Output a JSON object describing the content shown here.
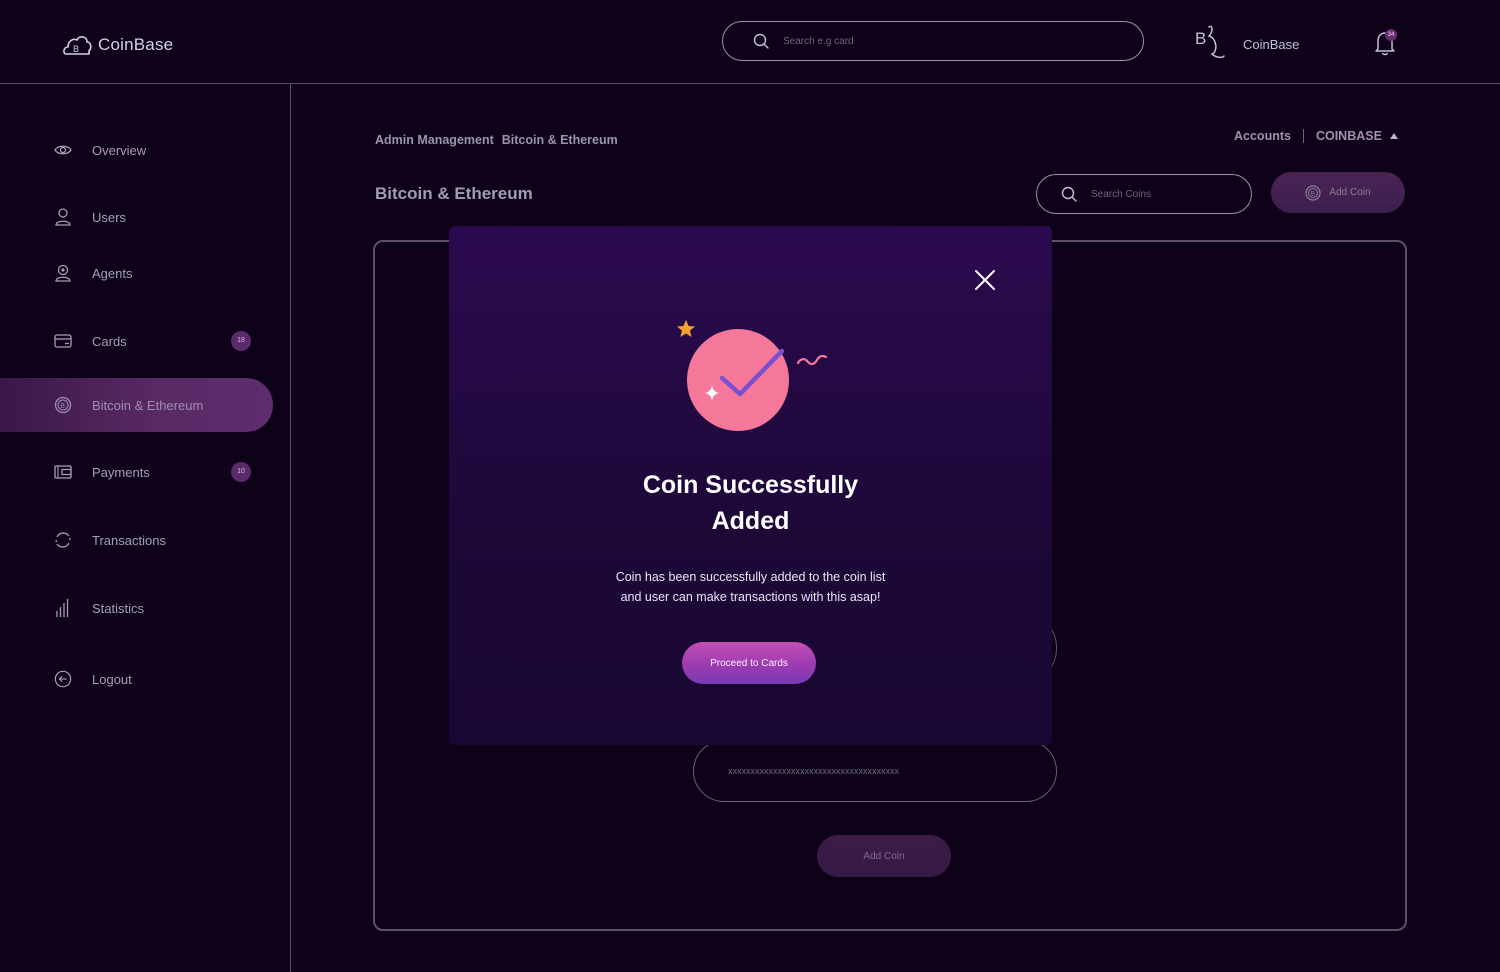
{
  "header": {
    "brand": "CoinBase",
    "search_placeholder": "Search e.g card",
    "user_name": "CoinBase",
    "notification_count": "34"
  },
  "sidebar": {
    "items": [
      {
        "label": "Overview",
        "icon": "eye-icon"
      },
      {
        "label": "Users",
        "icon": "user-icon"
      },
      {
        "label": "Agents",
        "icon": "agent-icon"
      },
      {
        "label": "Cards",
        "icon": "card-icon",
        "badge": "18"
      },
      {
        "label": "Bitcoin & Ethereum",
        "icon": "bitcoin-icon",
        "active": true
      },
      {
        "label": "Payments",
        "icon": "wallet-icon",
        "badge": "10"
      },
      {
        "label": "Transactions",
        "icon": "refresh-icon"
      },
      {
        "label": "Statistics",
        "icon": "chart-icon"
      },
      {
        "label": "Logout",
        "icon": "logout-icon"
      }
    ]
  },
  "main": {
    "breadcrumb": [
      "Admin Management",
      "Bitcoin & Ethereum"
    ],
    "accounts_label": "Accounts",
    "account_selector": "COINBASE",
    "page_title": "Bitcoin & Ethereum",
    "search_placeholder": "Search Coins",
    "add_coin_label": "Add Coin",
    "key_placeholder": "xxxxxxxxxxxxxxxxxxxxxxxxxxxxxxxxxxxxxx",
    "submit_label": "Add Coin"
  },
  "modal": {
    "title_line1": "Coin Successfully",
    "title_line2": "Added",
    "message_line1": "Coin has been successfully added to the coin list",
    "message_line2": "and user can make transactions with this asap!",
    "button_label": "Proceed to Cards"
  },
  "colors": {
    "background": "#0d0218",
    "accent_pink": "#f5789b",
    "accent_purple": "#9c3bb0",
    "star_orange": "#f7a12d"
  }
}
